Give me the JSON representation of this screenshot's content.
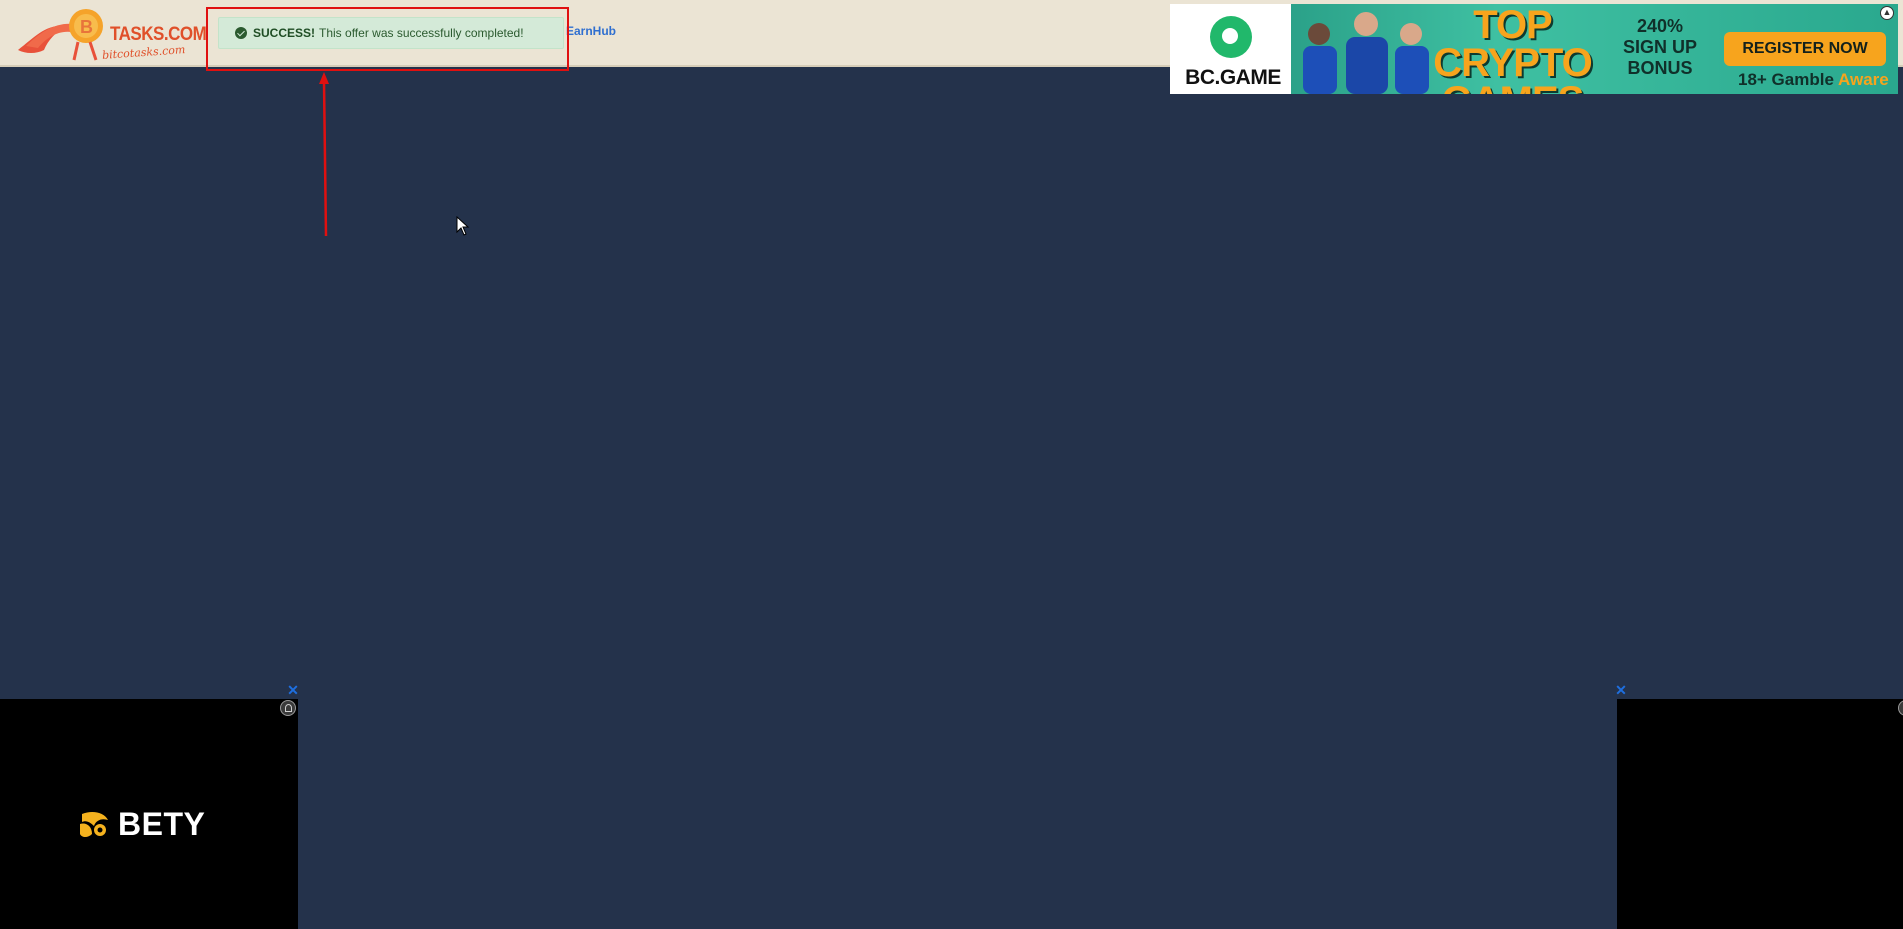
{
  "header": {
    "logo": {
      "main_text": "TASKS.COM",
      "sub_text": "bitcotasks.com"
    },
    "nav": {
      "earnhub_label": "EarnHub"
    }
  },
  "alert": {
    "status": "SUCCESS!",
    "message": "This offer was successfully completed!",
    "color": "#d4ead8"
  },
  "annotation": {
    "color": "#e01010"
  },
  "ads": {
    "top_banner": {
      "brand": "BC.GAME",
      "headline": "TOP CRYPTO GAMES",
      "bonus_lines": [
        "240%",
        "SIGN UP",
        "BONUS"
      ],
      "cta": "REGISTER NOW",
      "age_note": "18+ Gamble",
      "aware": "Aware"
    },
    "bottom_left": {
      "brand": "BETY"
    }
  },
  "colors": {
    "page_bg": "#24324b",
    "header_bg": "#ebe4d4",
    "link": "#2f6fd0",
    "close": "#1e6fe0"
  }
}
